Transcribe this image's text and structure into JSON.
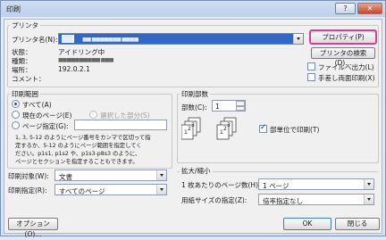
{
  "window": {
    "title": "印刷",
    "help": "?",
    "close": "✕"
  },
  "printer": {
    "group_label": "プリンタ",
    "name_label": "プリンタ名(N):",
    "name_value": "■■ ■■■■■■■ ■■■■",
    "status_label": "状態：",
    "status_value": "アイドリング中",
    "type_label": "種類：",
    "type_value": "■■■■■■■■■■ ■■■",
    "location_label": "場所：",
    "location_value": "192.0.2.1",
    "comment_label": "コメント：",
    "properties_button": "プロパティ(P)",
    "find_button": "プリンタの検索(D)...",
    "print_to_file": "ファイルへ出力(L)",
    "manual_duplex": "手差し両面印刷(X)"
  },
  "page_range": {
    "group_label": "印刷範囲",
    "all": "すべて(A)",
    "current": "現在のページ(E)",
    "selection": "選択した部分(S)",
    "pages": "ページ指定(G):",
    "help_text_1": "1, 3, 5-12 のようにページ番号をカンマで区切って指",
    "help_text_2": "定するか、5-12 のようにページ範囲を指定してく",
    "help_text_3": "ださい。p1s1, p1s2 や、p1s3-p8s3 のように、",
    "help_text_4": "ページとセクションを指定することもできます。"
  },
  "copies": {
    "group_label": "印刷部数",
    "count_label": "部数(C):",
    "count_value": "1",
    "collate": "部単位で印刷(T)"
  },
  "print_what": {
    "label": "印刷対象(W):",
    "value": "文書"
  },
  "print_option": {
    "label": "印刷指定(R):",
    "value": "すべてのページ"
  },
  "zoom": {
    "group_label": "拡大/縮小",
    "pages_per_sheet_label": "1 枚あたりのページ数(H):",
    "pages_per_sheet_value": "1 ページ",
    "scale_label": "用紙サイズの指定(Z):",
    "scale_value": "倍率指定なし"
  },
  "footer": {
    "options": "オプション(O)...",
    "ok": "OK",
    "close": "閉じる"
  }
}
